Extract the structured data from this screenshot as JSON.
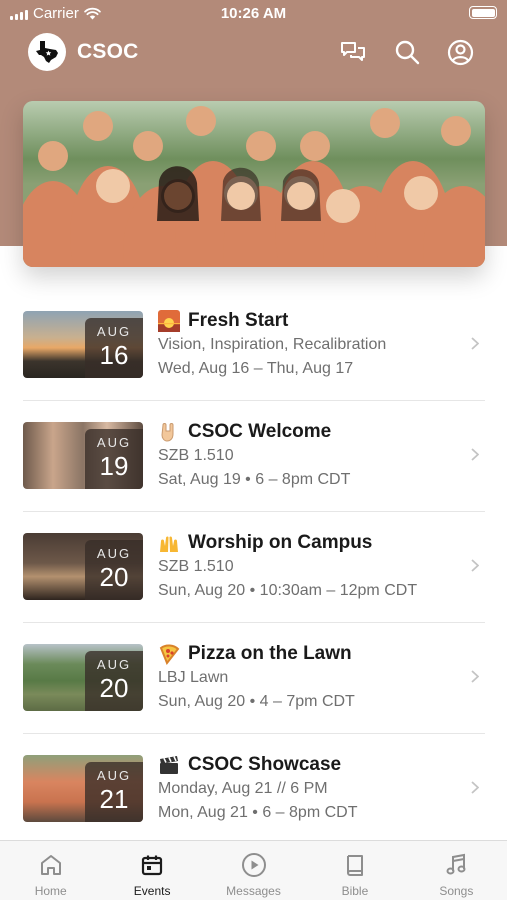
{
  "status_bar": {
    "carrier": "Carrier",
    "time": "10:26 AM"
  },
  "app": {
    "title": "CSOC"
  },
  "header_actions": [
    "messages-icon",
    "search-icon",
    "account-icon"
  ],
  "colors": {
    "header_bg": "#b38a79",
    "accent": "#1c1c1c",
    "muted_text": "#6f6f6f"
  },
  "events": [
    {
      "title": "Fresh Start",
      "emoji": "sunrise",
      "subtitle": "Vision, Inspiration, Recalibration",
      "when": "Wed, Aug 16 – Thu, Aug 17",
      "month": "AUG",
      "day": "16"
    },
    {
      "title": "CSOC Welcome",
      "emoji": "horns-hand",
      "subtitle": "SZB 1.510",
      "when": "Sat, Aug 19 • 6 – 8pm CDT",
      "month": "AUG",
      "day": "19"
    },
    {
      "title": "Worship on Campus",
      "emoji": "raised-hands",
      "subtitle": "SZB 1.510",
      "when": "Sun, Aug 20 • 10:30am – 12pm CDT",
      "month": "AUG",
      "day": "20"
    },
    {
      "title": "Pizza on the Lawn",
      "emoji": "pizza",
      "subtitle": "LBJ Lawn",
      "when": "Sun, Aug 20 • 4 – 7pm CDT",
      "month": "AUG",
      "day": "20"
    },
    {
      "title": "CSOC Showcase",
      "emoji": "clapper-board",
      "subtitle": "Monday, Aug 21 // 6 PM",
      "when": "Mon, Aug 21 • 6 – 8pm CDT",
      "month": "AUG",
      "day": "21"
    }
  ],
  "tabs": [
    {
      "label": "Home",
      "icon": "home-icon",
      "active": false
    },
    {
      "label": "Events",
      "icon": "calendar-icon",
      "active": true
    },
    {
      "label": "Messages",
      "icon": "play-icon",
      "active": false
    },
    {
      "label": "Bible",
      "icon": "book-icon",
      "active": false
    },
    {
      "label": "Songs",
      "icon": "music-note-icon",
      "active": false
    }
  ]
}
